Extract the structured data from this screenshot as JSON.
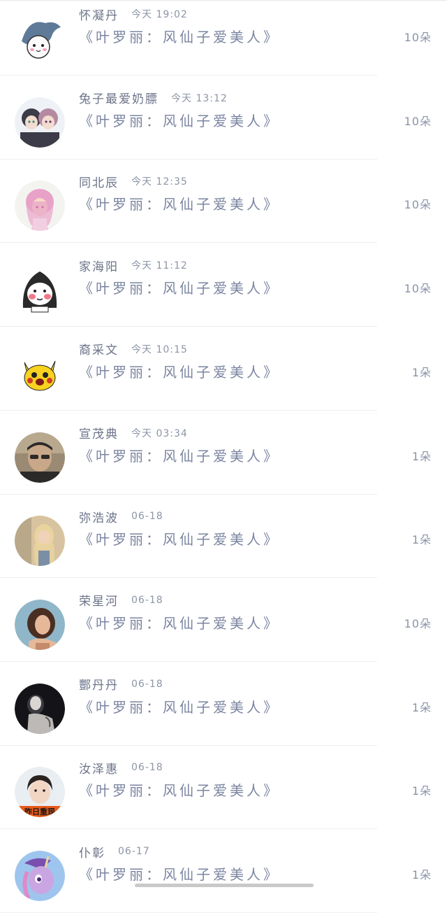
{
  "items": [
    {
      "name": "怀凝丹",
      "time": "今天 19:02",
      "title": "《叶罗丽：风仙子爱美人》",
      "count": "10朵",
      "avatar_icon": "shark-costume-avatar",
      "avatar_colors": [
        "#ffffff",
        "#5e7a98",
        "#f5a0b8"
      ]
    },
    {
      "name": "兔子最爱奶膘",
      "time": "今天 13:12",
      "title": "《叶罗丽：风仙子爱美人》",
      "count": "10朵",
      "avatar_icon": "anime-couple-avatar",
      "avatar_colors": [
        "#eef2f6",
        "#3c3c48",
        "#b58aa0"
      ]
    },
    {
      "name": "同北辰",
      "time": "今天 12:35",
      "title": "《叶罗丽：风仙子爱美人》",
      "count": "10朵",
      "avatar_icon": "pink-hair-girl-avatar",
      "avatar_colors": [
        "#f3f4f0",
        "#e8a2c8",
        "#f7d9c8"
      ]
    },
    {
      "name": "家海阳",
      "time": "今天 11:12",
      "title": "《叶罗丽：风仙子爱美人》",
      "count": "10朵",
      "avatar_icon": "hooded-doodle-avatar",
      "avatar_colors": [
        "#ffffff",
        "#2a2a2a",
        "#f07a8a"
      ]
    },
    {
      "name": "裔采文",
      "time": "今天 10:15",
      "title": "《叶罗丽：风仙子爱美人》",
      "count": "1朵",
      "avatar_icon": "pikachu-avatar",
      "avatar_colors": [
        "#ffffff",
        "#f7d21e",
        "#d23a2a"
      ]
    },
    {
      "name": "宣茂典",
      "time": "今天 03:34",
      "title": "《叶罗丽：风仙子爱美人》",
      "count": "1朵",
      "avatar_icon": "sunglasses-man-avatar",
      "avatar_colors": [
        "#9a8a74",
        "#2c2a28",
        "#c8a888"
      ]
    },
    {
      "name": "弥浩波",
      "time": "06-18",
      "title": "《叶罗丽：风仙子爱美人》",
      "count": "1朵",
      "avatar_icon": "blonde-woman-avatar",
      "avatar_colors": [
        "#d8c3a0",
        "#e9d39e",
        "#7a8ea6"
      ]
    },
    {
      "name": "荣星河",
      "time": "06-18",
      "title": "《叶罗丽：风仙子爱美人》",
      "count": "10朵",
      "avatar_icon": "portrait-woman-avatar",
      "avatar_colors": [
        "#8fb7c9",
        "#4a2e22",
        "#e6b89a"
      ]
    },
    {
      "name": "酆丹丹",
      "time": "06-18",
      "title": "《叶罗丽：风仙子爱美人》",
      "count": "1朵",
      "avatar_icon": "dark-portrait-avatar",
      "avatar_colors": [
        "#141418",
        "#d9d6d2",
        "#3a3a40"
      ]
    },
    {
      "name": "汝泽惠",
      "time": "06-18",
      "title": "《叶罗丽：风仙子爱美人》",
      "count": "1朵",
      "avatar_icon": "boy-photo-avatar",
      "avatar_colors": [
        "#e9eef2",
        "#2a2420",
        "#e85a1a"
      ],
      "avatar_text": "昨日重现"
    },
    {
      "name": "仆彰",
      "time": "06-17",
      "title": "《叶罗丽：风仙子爱美人》",
      "count": "1朵",
      "avatar_icon": "pony-character-avatar",
      "avatar_colors": [
        "#9ec5ee",
        "#7a4fb0",
        "#e08ac8"
      ]
    }
  ]
}
